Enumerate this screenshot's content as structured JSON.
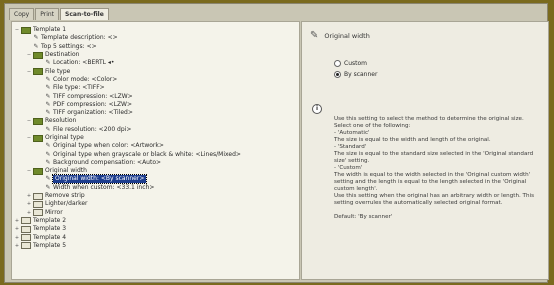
{
  "tabs": [
    "Copy",
    "Print",
    "Scan-to-file"
  ],
  "tree": [
    {
      "indent": 1,
      "kind": "folder",
      "exp": "−",
      "label": "Template 1"
    },
    {
      "indent": 2,
      "kind": "pen",
      "label": "Template description: <>"
    },
    {
      "indent": 2,
      "kind": "pen",
      "label": "Top 5 settings: <>"
    },
    {
      "indent": 2,
      "kind": "folder",
      "exp": "−",
      "label": "Destination"
    },
    {
      "indent": 3,
      "kind": "pen",
      "label": "Location: <BERTL ◂•"
    },
    {
      "indent": 2,
      "kind": "folder",
      "exp": "−",
      "label": "File type"
    },
    {
      "indent": 3,
      "kind": "pen",
      "label": "Color mode: <Color>"
    },
    {
      "indent": 3,
      "kind": "pen",
      "label": "File type: <TIFF>"
    },
    {
      "indent": 3,
      "kind": "pen",
      "label": "TIFF compression: <LZW>"
    },
    {
      "indent": 3,
      "kind": "pen",
      "label": "PDF compression: <LZW>"
    },
    {
      "indent": 3,
      "kind": "pen",
      "label": "TIFF organization: <Tiled>"
    },
    {
      "indent": 2,
      "kind": "folder",
      "exp": "−",
      "label": "Resolution"
    },
    {
      "indent": 3,
      "kind": "pen",
      "label": "File resolution: <200 dpi>"
    },
    {
      "indent": 2,
      "kind": "folder",
      "exp": "−",
      "label": "Original type"
    },
    {
      "indent": 3,
      "kind": "pen",
      "label": "Original type when color: <Artwork>"
    },
    {
      "indent": 3,
      "kind": "pen",
      "label": "Original type when grayscale or black & white: <Lines/Mixed>"
    },
    {
      "indent": 3,
      "kind": "pen",
      "label": "Background compensation: <Auto>"
    },
    {
      "indent": 2,
      "kind": "folder",
      "exp": "−",
      "label": "Original width"
    },
    {
      "indent": 3,
      "kind": "pen",
      "label": "Original width: <By scanner>",
      "selected": true
    },
    {
      "indent": 3,
      "kind": "pen",
      "label": "Width when custom: <33.1 inch>"
    },
    {
      "indent": 2,
      "kind": "closed",
      "exp": "+",
      "label": "Remove strip"
    },
    {
      "indent": 2,
      "kind": "closed",
      "exp": "+",
      "label": "Lighter/darker"
    },
    {
      "indent": 2,
      "kind": "closed",
      "exp": "+",
      "label": "Mirror"
    },
    {
      "indent": 1,
      "kind": "closed",
      "exp": "+",
      "label": "Template 2"
    },
    {
      "indent": 1,
      "kind": "closed",
      "exp": "+",
      "label": "Template 3"
    },
    {
      "indent": 1,
      "kind": "closed",
      "exp": "+",
      "label": "Template 4"
    },
    {
      "indent": 1,
      "kind": "closed",
      "exp": "+",
      "label": "Template 5"
    }
  ],
  "detail": {
    "title": "Original width",
    "options": [
      {
        "label": "Custom",
        "selected": false
      },
      {
        "label": "By scanner",
        "selected": true
      }
    ],
    "info_icon": "i",
    "help_lines": [
      "Use this setting to select the method to determine the original size.",
      "Select one of the following:",
      "- 'Automatic'",
      "The size is equal to the width and length of the original.",
      "- 'Standard'",
      "The size is equal to the standard size selected in the 'Original standard",
      "size' setting.",
      "- 'Custom'",
      "The width is equal to the width selected in the 'Original custom width'",
      "setting and the length is equal to the length selected in the 'Original",
      "custom length'.",
      "Use this setting when the original has an arbitrary width or length. This",
      "setting overrules the automatically selected original format.",
      "",
      "Default: 'By scanner'"
    ]
  },
  "colors": {
    "background": "#7a6a1e",
    "selection": "#1d3d8e",
    "folder_open": "#6f8a2a"
  }
}
